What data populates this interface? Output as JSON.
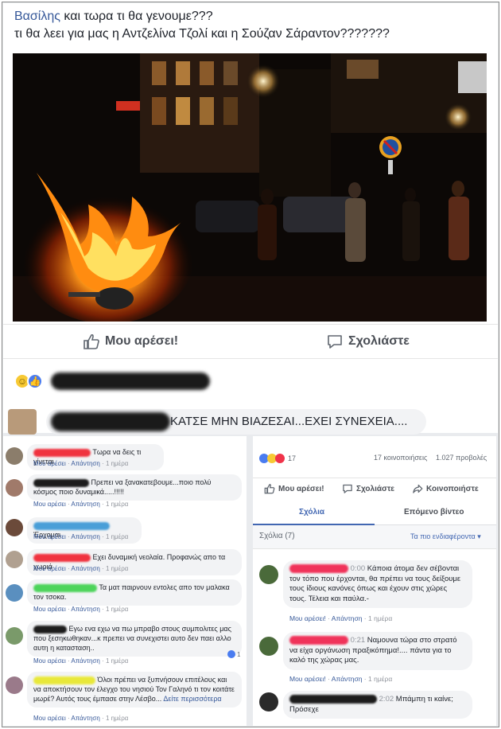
{
  "post": {
    "author": "Βασίλης",
    "line1_rest": " και τωρα τι θα γενουμε???",
    "line2": "τι θα λεει για μας η Αντζελίνα Τζολί και η Σούζαν Σάραντον???????",
    "like_label": "Μου αρέσει!",
    "comment_label": "Σχολιάστε",
    "top_comment_text": "ΚΑΤΣΕ ΜΗΝ ΒΙΑΖΕΣΑΙ...ΕΧΕΙ ΣΥΝΕΧΕΙΑ...."
  },
  "left_comments": [
    {
      "text": "Τωρα να δεις τι γίνεται",
      "name_color": "#f0333f",
      "avatar_color": "#8b7d6b"
    },
    {
      "text": "Πρεπει να ξανακατεβουμε...ποιο πολύ κόσμος ποιο δυναμικά.....!!!!!",
      "name_color": "#1c1c1c",
      "avatar_color": "#a07a6a"
    },
    {
      "text": "Έρχομαι",
      "name_color": "#4a9fd8",
      "avatar_color": "#6b4a3a"
    },
    {
      "text": "Εχει δυναμική νεολαία. Προφανώς απο τα χωριά",
      "name_color": "#f0333f",
      "avatar_color": "#b0a090"
    },
    {
      "text": "Τα ματ παιρνουν εντολες απο τον μαλακα τον τσοκα.",
      "name_color": "#4cd45a",
      "avatar_color": "#5a8fbf"
    },
    {
      "text": "Εγω ενα εχω να πω μπραβο στους συμπολιτες μας που ξεσηκωθηκαν...κ πρεπει να συνεχιστει αυτο δεν παει αλλο αυτη η κατασταση..",
      "name_color": "#1c1c1c",
      "avatar_color": "#7a9a6a"
    },
    {
      "text": "Όλοι πρέπει να ξυπνήσουν επιτέλους και να αποκτήσουν τον έλεγχο του νησιού Τον Γαληνό τι τον κοιτάτε μωρέ? Αυτός τους έμπασε στην Λέσβο...",
      "name_color": "#e8e83a",
      "avatar_color": "#9a7a8a",
      "more": "Δείτε περισσότερα"
    }
  ],
  "comment_meta": {
    "like": "Μου αρέσει",
    "reply": "Απάντηση",
    "time": "1 ημέρα",
    "reaction_count": "1"
  },
  "video_panel": {
    "reaction_count": "17",
    "shares": "17 κοινοποιήσεις",
    "views": "1.027 προβολές",
    "like_label": "Μου αρέσει!",
    "comment_label": "Σχολιάστε",
    "share_label": "Κοινοποιήστε",
    "tab_comments": "Σχόλια",
    "tab_next": "Επόμενο βίντεο",
    "comments_count": "Σχόλια (7)",
    "sort_label": "Τα πιο ενδιαφέροντα",
    "meta_like": "Μου αρέσει!",
    "meta_reply": "Απάντηση",
    "meta_time": "1 ημέρα",
    "comments": [
      {
        "timestamp": "0:00",
        "text": "Κάποια άτομα δεν σέβονται τον τόπο που έρχονται, θα πρέπει να τους δείξουμε τους ίδιους κανόνες όπως και έχουν στις χώρες τους. Τέλεια και παύλα.-",
        "name_color": "#f0335a"
      },
      {
        "timestamp": "0:21",
        "text": "Ναμουνα τώρα στο στρατό να είχα οργάνωση πραξικόπημα!.... πάντα για το καλό της χώρας μας.",
        "name_color": "#f0335a"
      },
      {
        "timestamp": "2:02",
        "text": "Μπάμπη τι καίνε; Πρόσεχε",
        "name_color": "#1c1c1c"
      }
    ]
  },
  "colors": {
    "link": "#365899",
    "fb_blue": "#4267b2",
    "bubble_bg": "#f2f3f5"
  }
}
